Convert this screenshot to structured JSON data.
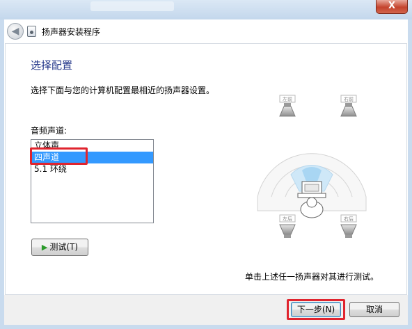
{
  "window": {
    "title": "扬声器安装程序",
    "close_label": "X"
  },
  "main": {
    "heading": "选择配置",
    "instruction": "选择下面与您的计算机配置最相近的扬声器设置。",
    "channels_label": "音频声道:",
    "channels": [
      "立体声",
      "四声道",
      "5.1 环绕"
    ],
    "selected_index": 1,
    "test_button": "测试(T)",
    "hint": "单击上述任一扬声器对其进行测试。"
  },
  "diagram": {
    "front_left": "左前",
    "front_right": "右前",
    "rear_left": "左后",
    "rear_right": "右后"
  },
  "footer": {
    "next_label": "下一步(N)",
    "cancel_label": "取消"
  },
  "colors": {
    "heading": "#1e3287",
    "selection": "#3399ff",
    "annotation": "#e0242e"
  }
}
